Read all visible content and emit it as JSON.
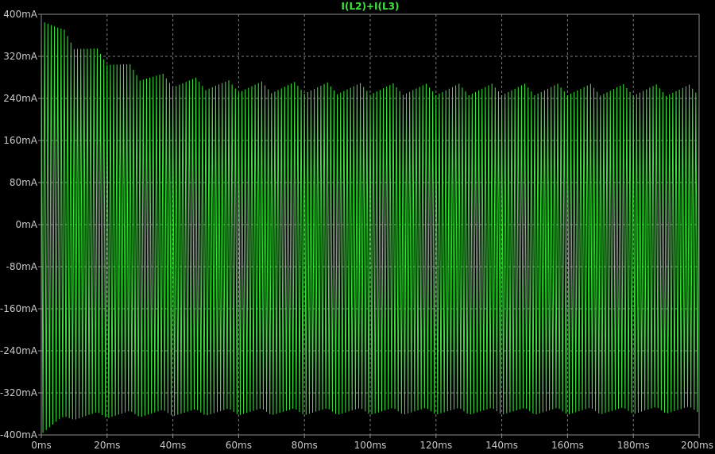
{
  "window": {
    "background": "#000000",
    "grid_color": "#7f7f7f",
    "axis_color": "#8c8c8c",
    "label_color": "#c8c8c8"
  },
  "chart_data": {
    "type": "line",
    "title": "I(L2)+I(L3)",
    "xlabel": "",
    "ylabel": "",
    "x_unit": "ms",
    "y_unit": "mA",
    "xlim": [
      0,
      200
    ],
    "ylim": [
      -400,
      400
    ],
    "grid": true,
    "xticks": [
      "0ms",
      "20ms",
      "40ms",
      "60ms",
      "80ms",
      "100ms",
      "120ms",
      "140ms",
      "160ms",
      "180ms",
      "200ms"
    ],
    "yticks": [
      "400mA",
      "320mA",
      "240mA",
      "160mA",
      "80mA",
      "0mA",
      "-80mA",
      "-160mA",
      "-240mA",
      "-320mA",
      "-400mA"
    ],
    "series": [
      {
        "name": "I(L2)+I(L3)",
        "color": "#3ce63c",
        "oscillation_frequency_hz": 1000,
        "envelope_x": [
          0,
          5,
          10,
          20,
          30,
          40,
          60,
          80,
          100,
          120,
          140,
          160,
          180,
          200
        ],
        "envelope_upper": [
          398,
          370,
          345,
          315,
          285,
          272,
          262,
          260,
          258,
          257,
          257,
          257,
          256,
          255
        ],
        "envelope_lower": [
          -392,
          -375,
          -365,
          -362,
          -360,
          -358,
          -356,
          -356,
          -355,
          -355,
          -355,
          -355,
          -354,
          -352
        ],
        "ripple_period_ms": 10,
        "ripple_amplitude": 22
      }
    ]
  }
}
